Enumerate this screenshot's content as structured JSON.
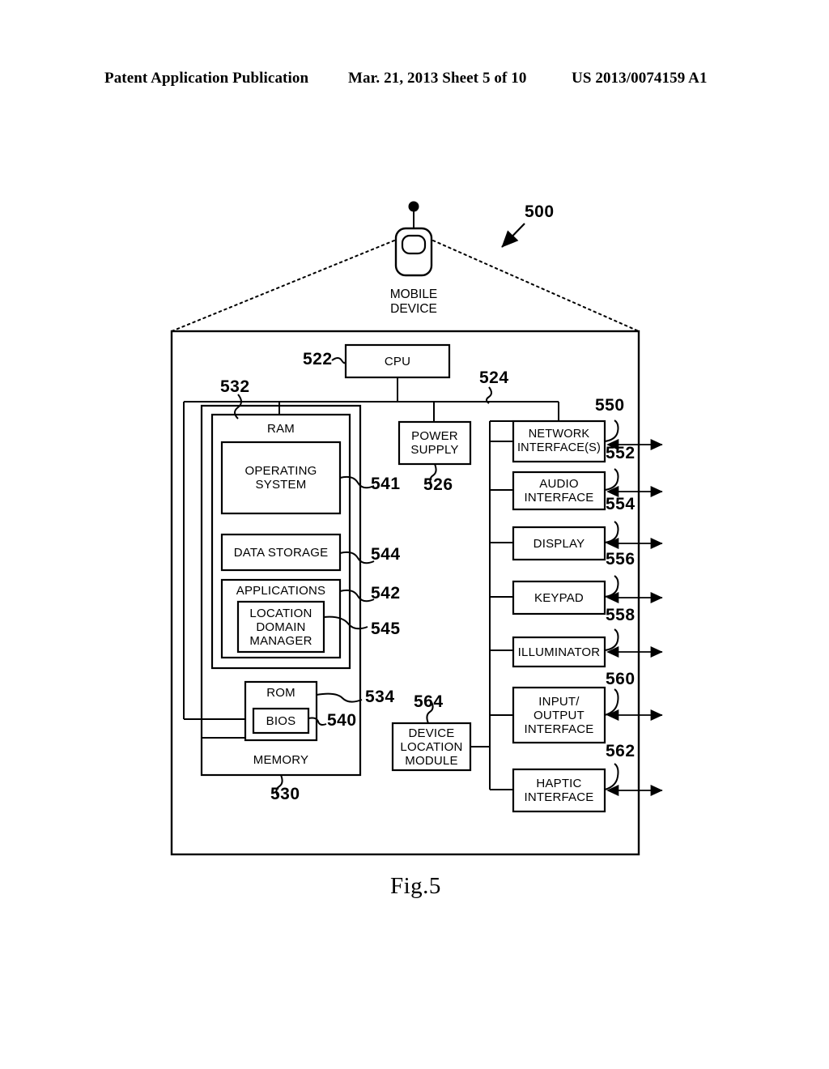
{
  "header": {
    "publication": "Patent Application Publication",
    "date_sheet": "Mar. 21, 2013  Sheet 5 of 10",
    "patent_number": "US 2013/0074159 A1"
  },
  "figure": {
    "caption": "Fig.5",
    "system_ref": "500"
  },
  "device": {
    "label": "MOBILE\nDEVICE"
  },
  "blocks": {
    "cpu": {
      "label": "CPU",
      "ref": "522"
    },
    "bus": {
      "ref": "524"
    },
    "ram": {
      "label": "RAM",
      "ref": "532"
    },
    "memory": {
      "label": "MEMORY",
      "ref": "530"
    },
    "os": {
      "label": "OPERATING\nSYSTEM",
      "ref": "541"
    },
    "data_store": {
      "label": "DATA STORAGE",
      "ref": "544"
    },
    "apps": {
      "label": "APPLICATIONS",
      "ref": "542"
    },
    "ldm": {
      "label": "LOCATION\nDOMAIN\nMANAGER",
      "ref": "545"
    },
    "rom": {
      "label": "ROM",
      "ref": "534"
    },
    "bios": {
      "label": "BIOS",
      "ref": "540"
    },
    "power": {
      "label": "POWER\nSUPPLY",
      "ref": "526"
    },
    "dlm": {
      "label": "DEVICE\nLOCATION\nMODULE",
      "ref": "564"
    },
    "network": {
      "label": "NETWORK\nINTERFACE(S)",
      "ref": "550"
    },
    "audio": {
      "label": "AUDIO\nINTERFACE",
      "ref": "552"
    },
    "display": {
      "label": "DISPLAY",
      "ref": "554"
    },
    "keypad": {
      "label": "KEYPAD",
      "ref": "556"
    },
    "illuminator": {
      "label": "ILLUMINATOR",
      "ref": "558"
    },
    "io": {
      "label": "INPUT/\nOUTPUT\nINTERFACE",
      "ref": "560"
    },
    "haptic": {
      "label": "HAPTIC\nINTERFACE",
      "ref": "562"
    }
  },
  "colors": {
    "ink": "#000000",
    "paper": "#ffffff"
  }
}
